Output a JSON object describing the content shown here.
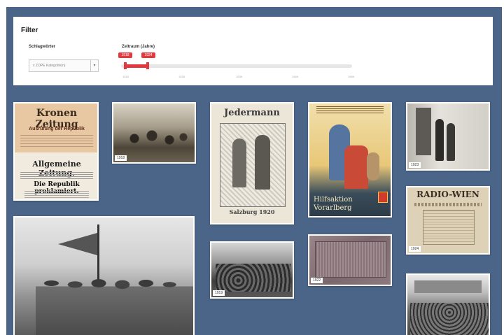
{
  "filter": {
    "title": "Filter",
    "category_label": "Schlagwörter",
    "category_value": "x ZOPE Kategorie(n)",
    "range_label": "Zeitraum (Jahre)",
    "range_from": "1918",
    "range_to": "1924",
    "range_selected_fraction": [
      0.02,
      0.12
    ],
    "ticks": [
      "1918",
      "1928",
      "1938",
      "1948",
      "1958"
    ]
  },
  "colors": {
    "background": "#4b6588",
    "accent": "#e2383f",
    "panel": "#ffffff"
  },
  "cards": [
    {
      "id": "newspaper",
      "title_top": "Kronen Zeitung",
      "headline_top": "Ausrufung der Republik",
      "title_bottom": "Allgemeine Zeitung.",
      "headline_bottom": "Die Republik proklamiert."
    },
    {
      "id": "crowd-photo",
      "year": "1918"
    },
    {
      "id": "jedermann",
      "title": "Jedermann",
      "subtitle": "Salzburg 1920"
    },
    {
      "id": "vorarlberg",
      "title": "Hilfsaktion Vorarlberg"
    },
    {
      "id": "street-photo",
      "year": "1923"
    },
    {
      "id": "radio",
      "title": "RADIO-WIEN",
      "year": "1924"
    },
    {
      "id": "soldiers-photo"
    },
    {
      "id": "crowd2-photo",
      "year": "1919"
    },
    {
      "id": "banknote",
      "year": "1922"
    },
    {
      "id": "rally-photo"
    }
  ]
}
